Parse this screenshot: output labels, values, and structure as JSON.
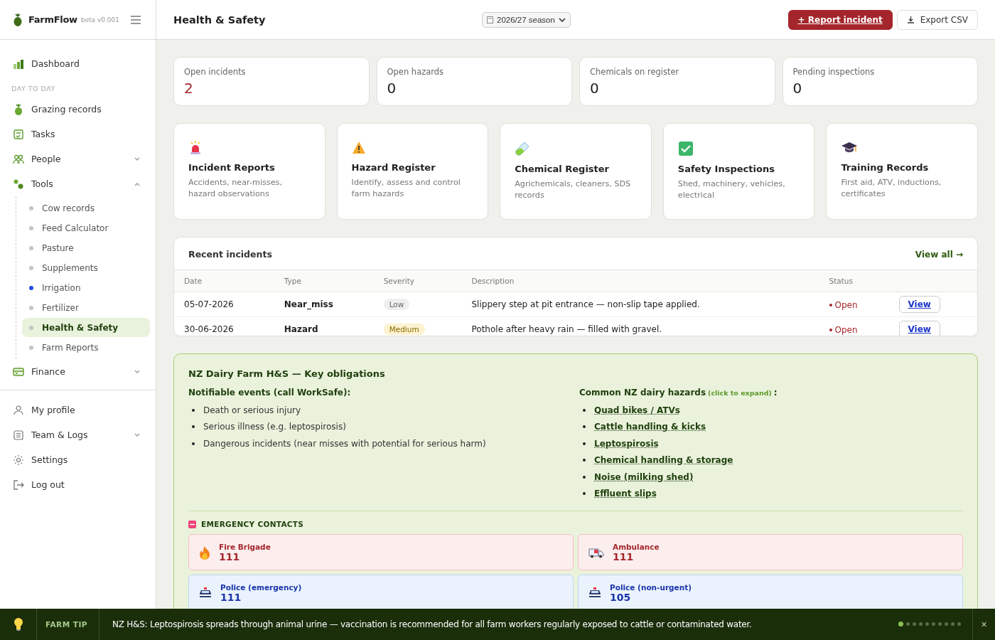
{
  "brand": {
    "name": "FarmFlow",
    "version": "beta v0.001"
  },
  "sidebar": {
    "items": [
      {
        "label": "Dashboard"
      }
    ],
    "section": "DAY TO DAY",
    "groups": [
      {
        "label": "Grazing records"
      },
      {
        "label": "Tasks"
      },
      {
        "label": "People",
        "expanded": false
      },
      {
        "label": "Tools",
        "expanded": true,
        "children": [
          {
            "label": "Cow records",
            "color": "#c4c4c4",
            "selected": false
          },
          {
            "label": "Feed Calculator",
            "color": "#c4c4c4",
            "selected": false
          },
          {
            "label": "Pasture",
            "color": "#c4c4c4",
            "selected": false
          },
          {
            "label": "Supplements",
            "color": "#c4c4c4",
            "selected": false
          },
          {
            "label": "Irrigation",
            "color": "#1d4ed8",
            "selected": false
          },
          {
            "label": "Fertilizer",
            "color": "#c4c4c4",
            "selected": false
          },
          {
            "label": "Health & Safety",
            "color": "#c4c4c4",
            "selected": true
          },
          {
            "label": "Farm Reports",
            "color": "#c4c4c4",
            "selected": false
          }
        ]
      },
      {
        "label": "Finance",
        "expanded": false
      }
    ],
    "account": [
      {
        "label": "My profile"
      },
      {
        "label": "Team & Logs",
        "expanded": false
      },
      {
        "label": "Settings"
      },
      {
        "label": "Log out"
      }
    ]
  },
  "header": {
    "title": "Health & Safety",
    "season": "2026/27 season",
    "report_button": "+ Report incident",
    "export_button": "Export CSV"
  },
  "stats": [
    {
      "label": "Open incidents",
      "value": "2",
      "alert": true
    },
    {
      "label": "Open hazards",
      "value": "0",
      "alert": false
    },
    {
      "label": "Chemicals on register",
      "value": "0",
      "alert": false
    },
    {
      "label": "Pending inspections",
      "value": "0",
      "alert": false
    }
  ],
  "modules": [
    {
      "kind": "siren",
      "title": "Incident Reports",
      "description": "Accidents, near-misses, hazard observations"
    },
    {
      "kind": "warning",
      "title": "Hazard Register",
      "description": "Identify, assess and control farm hazards"
    },
    {
      "kind": "tube",
      "title": "Chemical Register",
      "description": "Agrichemicals, cleaners, SDS records"
    },
    {
      "kind": "check",
      "title": "Safety Inspections",
      "description": "Shed, machinery, vehicles, electrical"
    },
    {
      "kind": "cap",
      "title": "Training Records",
      "description": "First aid, ATV, inductions, certificates"
    }
  ],
  "recent": {
    "title": "Recent incidents",
    "view_all": "View all →",
    "columns": [
      "Date",
      "Type",
      "Severity",
      "Description",
      "Status"
    ],
    "rows": [
      {
        "date": "05-07-2026",
        "type": "Near_miss",
        "severity": "Low",
        "kind": "low",
        "description": "Slippery step at pit entrance — non-slip tape applied.",
        "status": "Open",
        "action": "View"
      },
      {
        "date": "30-06-2026",
        "type": "Hazard",
        "severity": "Medium",
        "kind": "medium",
        "description": "Pothole after heavy rain — filled with gravel.",
        "status": "Open",
        "action": "View"
      }
    ]
  },
  "obligations": {
    "title": "NZ Dairy Farm H&S — Key obligations",
    "notifiable_title": "Notifiable events (call WorkSafe):",
    "notifiable": [
      "Death or serious injury",
      "Serious illness (e.g. leptospirosis)",
      "Dangerous incidents (near misses with potential for serious harm)"
    ],
    "hazards_title": "Common NZ dairy hazards",
    "hazards_hint": "(click to expand)",
    "hazards_colon": ":",
    "hazards": [
      "Quad bikes / ATVs",
      "Cattle handling & kicks",
      "Leptospirosis",
      "Chemical handling & storage",
      "Noise (milking shed)",
      "Effluent slips"
    ],
    "emergency_title": "EMERGENCY CONTACTS",
    "contacts": [
      {
        "kind": "fire",
        "name": "Fire Brigade",
        "number": "111"
      },
      {
        "kind": "ambulance",
        "name": "Ambulance",
        "number": "111"
      },
      {
        "kind": "police",
        "name": "Police (emergency)",
        "number": "111"
      },
      {
        "kind": "police",
        "name": "Police (non-urgent)",
        "number": "105"
      }
    ]
  },
  "tip": {
    "label": "FARM TIP",
    "text": "NZ H&S: Leptospirosis spreads through animal urine — vaccination is recommended for all farm workers regularly exposed to cattle or contaminated water.",
    "close": "×",
    "pages": [
      {
        "selected": true
      },
      {
        "selected": false
      },
      {
        "selected": false
      },
      {
        "selected": false
      },
      {
        "selected": false
      },
      {
        "selected": false
      },
      {
        "selected": false
      },
      {
        "selected": false
      },
      {
        "selected": false
      },
      {
        "selected": false
      }
    ]
  }
}
